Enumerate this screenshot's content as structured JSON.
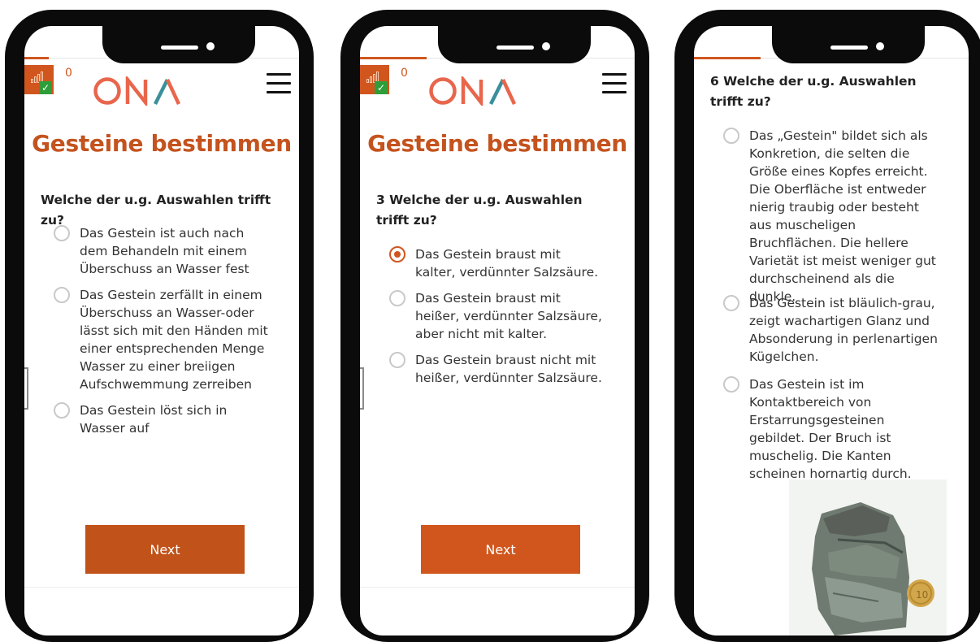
{
  "app": {
    "title": "Gesteine bestimmen",
    "score": "0",
    "logo_text": "ONA",
    "next_label": "Next"
  },
  "screens": [
    {
      "question": "Welche der u.g. Auswahlen trifft zu?",
      "options": [
        {
          "label": "Das Gestein ist auch nach dem Behandeln mit einem Überschuss an Wasser fest",
          "selected": false
        },
        {
          "label": "Das Gestein zerfällt in einem Überschuss an Wasser-oder lässt sich mit den Händen mit einer entsprechenden Menge Wasser zu einer breiigen Aufschwemmung zerreiben",
          "selected": false
        },
        {
          "label": "Das Gestein löst sich in Wasser auf",
          "selected": false
        }
      ]
    },
    {
      "question": "3 Welche der u.g. Auswahlen trifft zu?",
      "options": [
        {
          "label": "Das Gestein braust mit kalter, verdünnter Salzsäure.",
          "selected": true
        },
        {
          "label": "Das Gestein braust mit heißer, verdünnter Salzsäure, aber nicht mit kalter.",
          "selected": false
        },
        {
          "label": "Das Gestein braust nicht mit heißer, verdünnter Salzsäure.",
          "selected": false
        }
      ]
    },
    {
      "question": "6 Welche der u.g. Auswahlen trifft zu?",
      "options": [
        {
          "label": "Das „Gestein\" bildet sich als Konkretion, die selten die Größe eines Kopfes erreicht. Die Oberfläche ist entweder nierig traubig oder besteht aus muscheligen Bruchflächen. Die hellere Varietät ist meist weniger gut durchscheinend als die dunkle.",
          "selected": false
        },
        {
          "label": "Das Gestein ist bläulich-grau, zeigt wachartigen Glanz und Absonderung in perlenartigen Kügelchen.",
          "selected": false
        },
        {
          "label": "Das Gestein ist im Kontaktbereich von Erstarrungsgesteinen gebildet. Der Bruch ist muschelig. Die Kanten scheinen hornartig durch.",
          "selected": false
        }
      ]
    }
  ],
  "colors": {
    "accent": "#d0561e",
    "title": "#c4531e",
    "next_button_1": "#c0521a",
    "next_button_2": "#d0561e",
    "check_green": "#2e9e3a",
    "logo_coral": "#e8664c",
    "logo_teal": "#3a8f9a"
  },
  "icons": {
    "level": "signal-bars-icon",
    "check": "check-icon",
    "menu": "hamburger-menu-icon",
    "radio": "radio-button-icon"
  },
  "progress": {
    "screen1": 0.09,
    "screen2": 0.24,
    "screen3": 0.24
  }
}
